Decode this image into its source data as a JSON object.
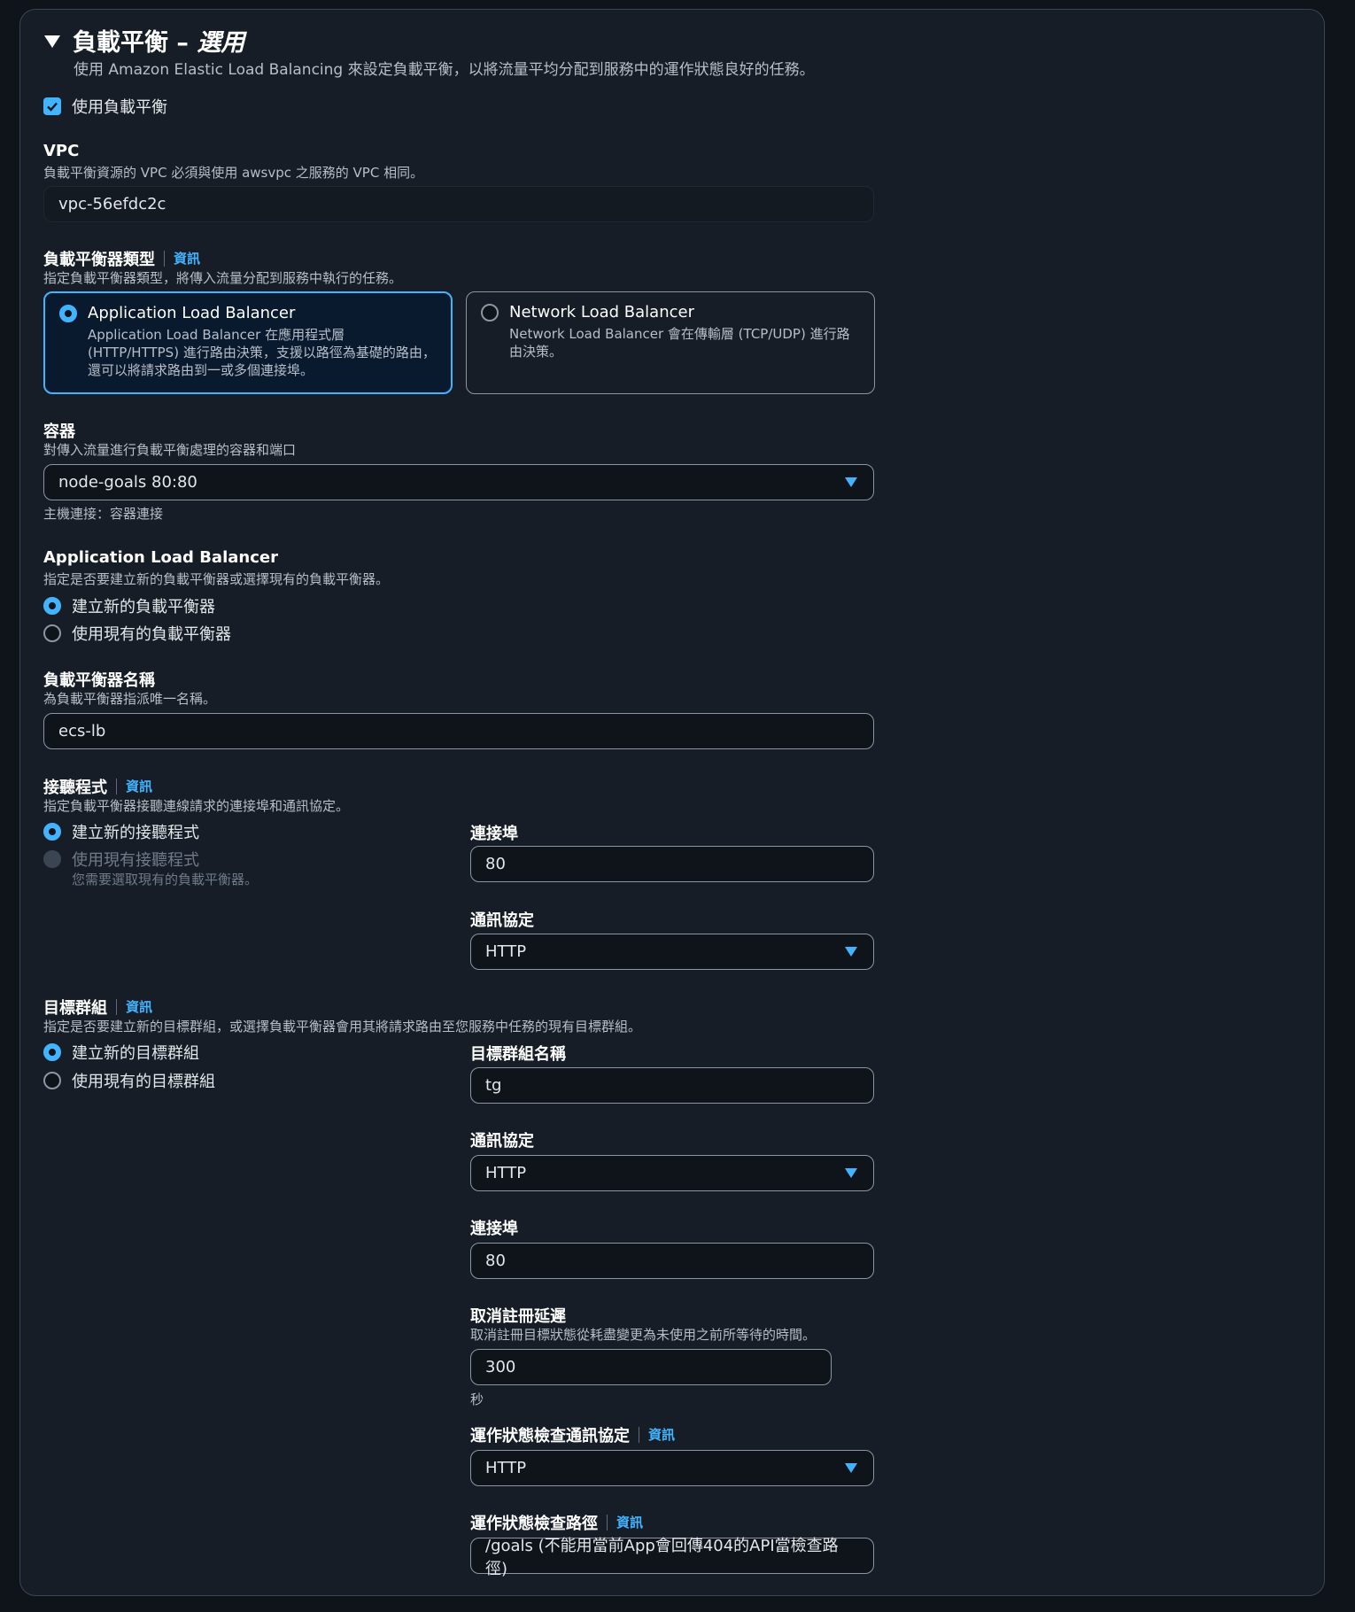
{
  "section": {
    "title": "負載平衡",
    "title_suffix": "選用",
    "title_sep": " – ",
    "description": "使用 Amazon Elastic Load Balancing 來設定負載平衡，以將流量平均分配到服務中的運作狀態良好的任務。",
    "use_lb_label": "使用負載平衡",
    "use_lb_checked": true
  },
  "vpc": {
    "label": "VPC",
    "description": "負載平衡資源的 VPC 必須與使用 awsvpc 之服務的 VPC 相同。",
    "value": "vpc-56efdc2c"
  },
  "lb_type": {
    "label": "負載平衡器類型",
    "info": "資訊",
    "description": "指定負載平衡器類型，將傳入流量分配到服務中執行的任務。",
    "options": [
      {
        "title": "Application Load Balancer",
        "description": "Application Load Balancer 在應用程式層 (HTTP/HTTPS) 進行路由決策，支援以路徑為基礎的路由，還可以將請求路由到一或多個連接埠。",
        "selected": true
      },
      {
        "title": "Network Load Balancer",
        "description": "Network Load Balancer 會在傳輸層 (TCP/UDP) 進行路由決策。",
        "selected": false
      }
    ]
  },
  "container": {
    "label": "容器",
    "description": "對傳入流量進行負載平衡處理的容器和端口",
    "value": "node-goals 80:80",
    "footer": "主機連接：容器連接"
  },
  "alb": {
    "label": "Application Load Balancer",
    "description": "指定是否要建立新的負載平衡器或選擇現有的負載平衡器。",
    "options": [
      {
        "label": "建立新的負載平衡器",
        "selected": true
      },
      {
        "label": "使用現有的負載平衡器",
        "selected": false
      }
    ]
  },
  "lb_name": {
    "label": "負載平衡器名稱",
    "description": "為負載平衡器指派唯一名稱。",
    "value": "ecs-lb"
  },
  "listener": {
    "label": "接聽程式",
    "info": "資訊",
    "description": "指定負載平衡器接聽連線請求的連接埠和通訊協定。",
    "options": [
      {
        "label": "建立新的接聽程式",
        "selected": true
      },
      {
        "label": "使用現有接聽程式",
        "sublabel": "您需要選取現有的負載平衡器。",
        "disabled": true
      }
    ],
    "port_label": "連接埠",
    "port_value": "80",
    "protocol_label": "通訊協定",
    "protocol_value": "HTTP"
  },
  "target_group": {
    "label": "目標群組",
    "info": "資訊",
    "description": "指定是否要建立新的目標群組，或選擇負載平衡器會用其將請求路由至您服務中任務的現有目標群組。",
    "options": [
      {
        "label": "建立新的目標群組",
        "selected": true
      },
      {
        "label": "使用現有的目標群組",
        "selected": false
      }
    ],
    "name_label": "目標群組名稱",
    "name_value": "tg",
    "protocol_label": "通訊協定",
    "protocol_value": "HTTP",
    "port_label": "連接埠",
    "port_value": "80",
    "dereg_label": "取消註冊延遲",
    "dereg_description": "取消註冊目標狀態從耗盡變更為未使用之前所等待的時間。",
    "dereg_value": "300",
    "dereg_unit": "秒",
    "hc_protocol_label": "運作狀態檢查通訊協定",
    "hc_protocol_info": "資訊",
    "hc_protocol_value": "HTTP",
    "hc_path_label": "運作狀態檢查路徑",
    "hc_path_info": "資訊",
    "hc_path_value": "/goals (不能用當前App會回傳404的API當檢查路徑)"
  },
  "colors": {
    "accent": "#42b4ff",
    "background": "#0f141a",
    "panel": "#161d26"
  }
}
